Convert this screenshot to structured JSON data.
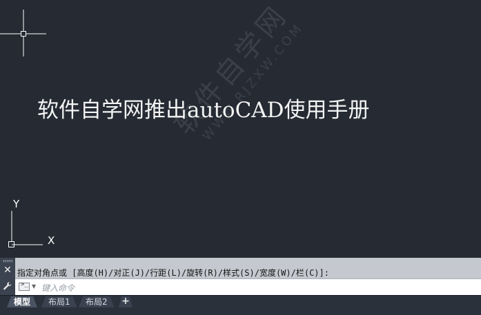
{
  "canvas": {
    "mtext": "软件自学网推出autoCAD使用手册",
    "watermark_main": "软件自学网",
    "watermark_sub": "WWW.RJZXW.COM"
  },
  "ucs": {
    "x_label": "X",
    "y_label": "Y"
  },
  "command_line": {
    "history": "指定对角点或 [高度(H)/对正(J)/行距(L)/旋转(R)/样式(S)/宽度(W)/栏(C)]:",
    "input_placeholder": "键入命令",
    "input_value": ""
  },
  "tabs": [
    {
      "label": "模型",
      "active": true
    },
    {
      "label": "布局1",
      "active": false
    },
    {
      "label": "布局2",
      "active": false
    }
  ],
  "tab_add_label": "+",
  "icons": [
    "crosshair-cursor-icon",
    "ucs-icon",
    "close-icon",
    "wrench-icon",
    "command-prompt-icon",
    "chevron-down-icon"
  ],
  "colors": {
    "canvas_background": "#252a33",
    "command_history_background": "#c5c9cf",
    "text_color": "#f3f3f3"
  }
}
